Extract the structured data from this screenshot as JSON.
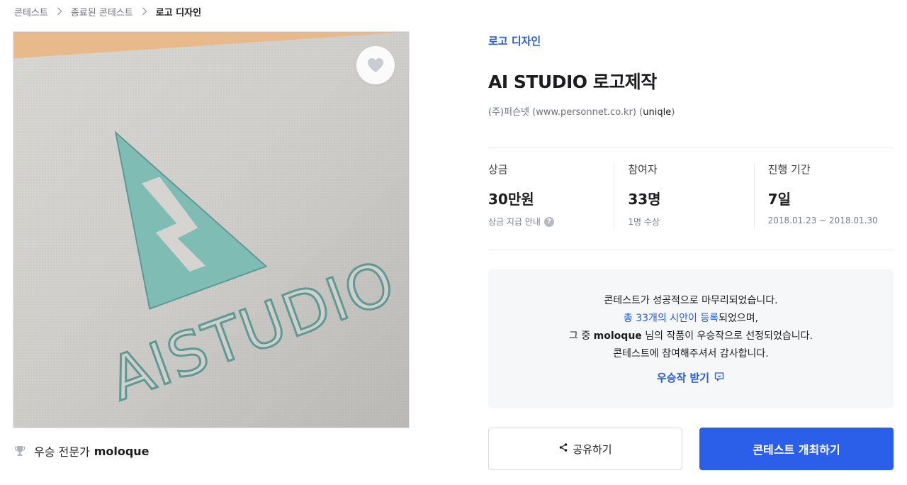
{
  "breadcrumb": {
    "items": [
      "콘테스트",
      "종료된 콘테스트",
      "로고 디자인"
    ]
  },
  "hero": {
    "logo_text": "AISTUDIO",
    "like_icon": "heart-icon"
  },
  "winner": {
    "label": "우승 전문가",
    "name": "moloque",
    "icon": "trophy-icon"
  },
  "contest": {
    "category": "로고 디자인",
    "title": "AI STUDIO 로고제작",
    "host": "(주)퍼슨넷 (www.personnet.co.kr)",
    "host_id_open": "(",
    "host_id": "uniqle",
    "host_id_close": ")"
  },
  "stats": [
    {
      "label": "상금",
      "value": "30만원",
      "sub": "상금 지급 안내",
      "help": "?"
    },
    {
      "label": "참여자",
      "value": "33명",
      "sub": "1명 수상"
    },
    {
      "label": "진행 기간",
      "value": "7일",
      "sub": "2018.01.23 ~ 2018.01.30"
    }
  ],
  "notice": {
    "line1": "콘테스트가 성공적으로 마무리되었습니다.",
    "line2_link": "총 33개의 시안이 등록",
    "line2_rest": "되었으며,",
    "line3_pre": "그 중 ",
    "line3_name": "moloque",
    "line3_rest": " 님의 작품이 우승작으로 선정되었습니다.",
    "line4": "콘테스트에 참여해주셔서 감사합니다.",
    "receive_label": "우승작 받기"
  },
  "actions": {
    "share_label": "공유하기",
    "open_label": "콘테스트 개최하기"
  },
  "colors": {
    "accent": "#2a5bd7",
    "primary_button": "#2b5fe9",
    "logo_teal": "#7fbcb4"
  }
}
